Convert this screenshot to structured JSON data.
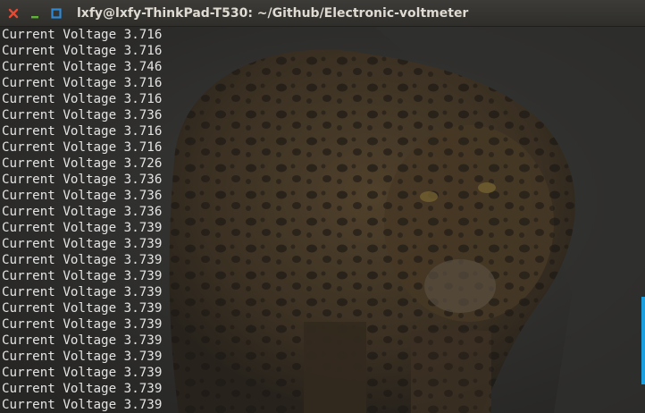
{
  "window": {
    "title": "lxfy@lxfy-ThinkPad-T530: ~/Github/Electronic-voltmeter"
  },
  "colors": {
    "close": "#e64a33",
    "minimize": "#5fb436",
    "maximize": "#2e89d6",
    "scrollbar": "#1aa0e0"
  },
  "terminal": {
    "lines": [
      "Current Voltage 3.716",
      "Current Voltage 3.716",
      "Current Voltage 3.746",
      "Current Voltage 3.716",
      "Current Voltage 3.716",
      "Current Voltage 3.736",
      "Current Voltage 3.716",
      "Current Voltage 3.716",
      "Current Voltage 3.726",
      "Current Voltage 3.736",
      "Current Voltage 3.736",
      "Current Voltage 3.736",
      "Current Voltage 3.739",
      "Current Voltage 3.739",
      "Current Voltage 3.739",
      "Current Voltage 3.739",
      "Current Voltage 3.739",
      "Current Voltage 3.739",
      "Current Voltage 3.739",
      "Current Voltage 3.739",
      "Current Voltage 3.739",
      "Current Voltage 3.739",
      "Current Voltage 3.739",
      "Current Voltage 3.739"
    ]
  },
  "icons": {
    "close": "close-icon",
    "minimize": "minimize-icon",
    "maximize": "maximize-icon",
    "background": "leopard-wallpaper"
  }
}
